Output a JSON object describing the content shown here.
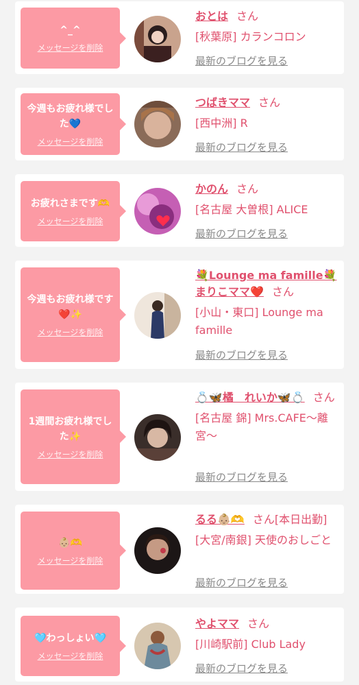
{
  "common": {
    "delete_label": "メッセージを削除",
    "blog_label": "最新のブログを見る",
    "san_label": "さん"
  },
  "colors": {
    "bubble": "#fc9aa4",
    "name": "#e0516e",
    "blog_link": "#8a8a8a",
    "background": "#f3f3f3"
  },
  "cards": [
    {
      "message": "^_^",
      "name": "おとは",
      "san": "さん",
      "shop": "[秋葉原] カランコロン"
    },
    {
      "message": "今週もお疲れ様でした💙",
      "name": "つばきママ",
      "san": "さん",
      "shop": "[西中洲] R"
    },
    {
      "message": "お疲れさまです🫶",
      "name": "かのん",
      "san": "さん",
      "shop": "[名古屋 大曽根] ALICE"
    },
    {
      "message": "今週もお疲れ様です❤️✨",
      "name": "💐Lounge ma famille💐まりこママ❤️",
      "san": "さん",
      "shop": "[小山・東口] Lounge ma famille"
    },
    {
      "message": "1週間お疲れ様でした✨",
      "name": "💍🦋橘　れいか🦋💍",
      "san": "さん",
      "shop": "[名古屋 錦] Mrs.CAFE〜離宮〜"
    },
    {
      "message": "👶🏼🫶",
      "name": "るる👶🏼🫶",
      "san": "さん[本日出勤]",
      "shop": "[大宮/南銀] 天使のおしごと"
    },
    {
      "message": "🩵わっしょい🩵",
      "name": "やよママ",
      "san": "さん",
      "shop": "[川崎駅前] Club Lady"
    }
  ]
}
